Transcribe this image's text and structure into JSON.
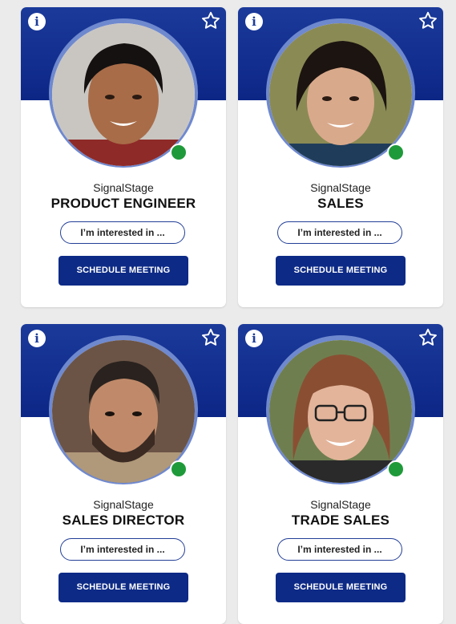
{
  "cards": [
    {
      "company": "SignalStage",
      "role": "PRODUCT ENGINEER",
      "interest_label": "I’m interested in ...",
      "schedule_label": "SCHEDULE MEETING",
      "info_glyph": "i",
      "status": "online"
    },
    {
      "company": "SignalStage",
      "role": "SALES",
      "interest_label": "I’m interested in ...",
      "schedule_label": "SCHEDULE MEETING",
      "info_glyph": "i",
      "status": "online"
    },
    {
      "company": "SignalStage",
      "role": "SALES DIRECTOR",
      "interest_label": "I’m interested in ...",
      "schedule_label": "SCHEDULE MEETING",
      "info_glyph": "i",
      "status": "online"
    },
    {
      "company": "SignalStage",
      "role": "TRADE SALES",
      "interest_label": "I’m interested in ...",
      "schedule_label": "SCHEDULE MEETING",
      "info_glyph": "i",
      "status": "online"
    }
  ],
  "icons": {
    "info": "info-icon",
    "favorite": "star-outline-icon",
    "status": "online-status-dot"
  },
  "colors": {
    "banner": "#0c2686",
    "ring": "#6f89cf",
    "button": "#0d2a86",
    "status_online": "#1f9a3a",
    "background": "#ebebeb"
  }
}
